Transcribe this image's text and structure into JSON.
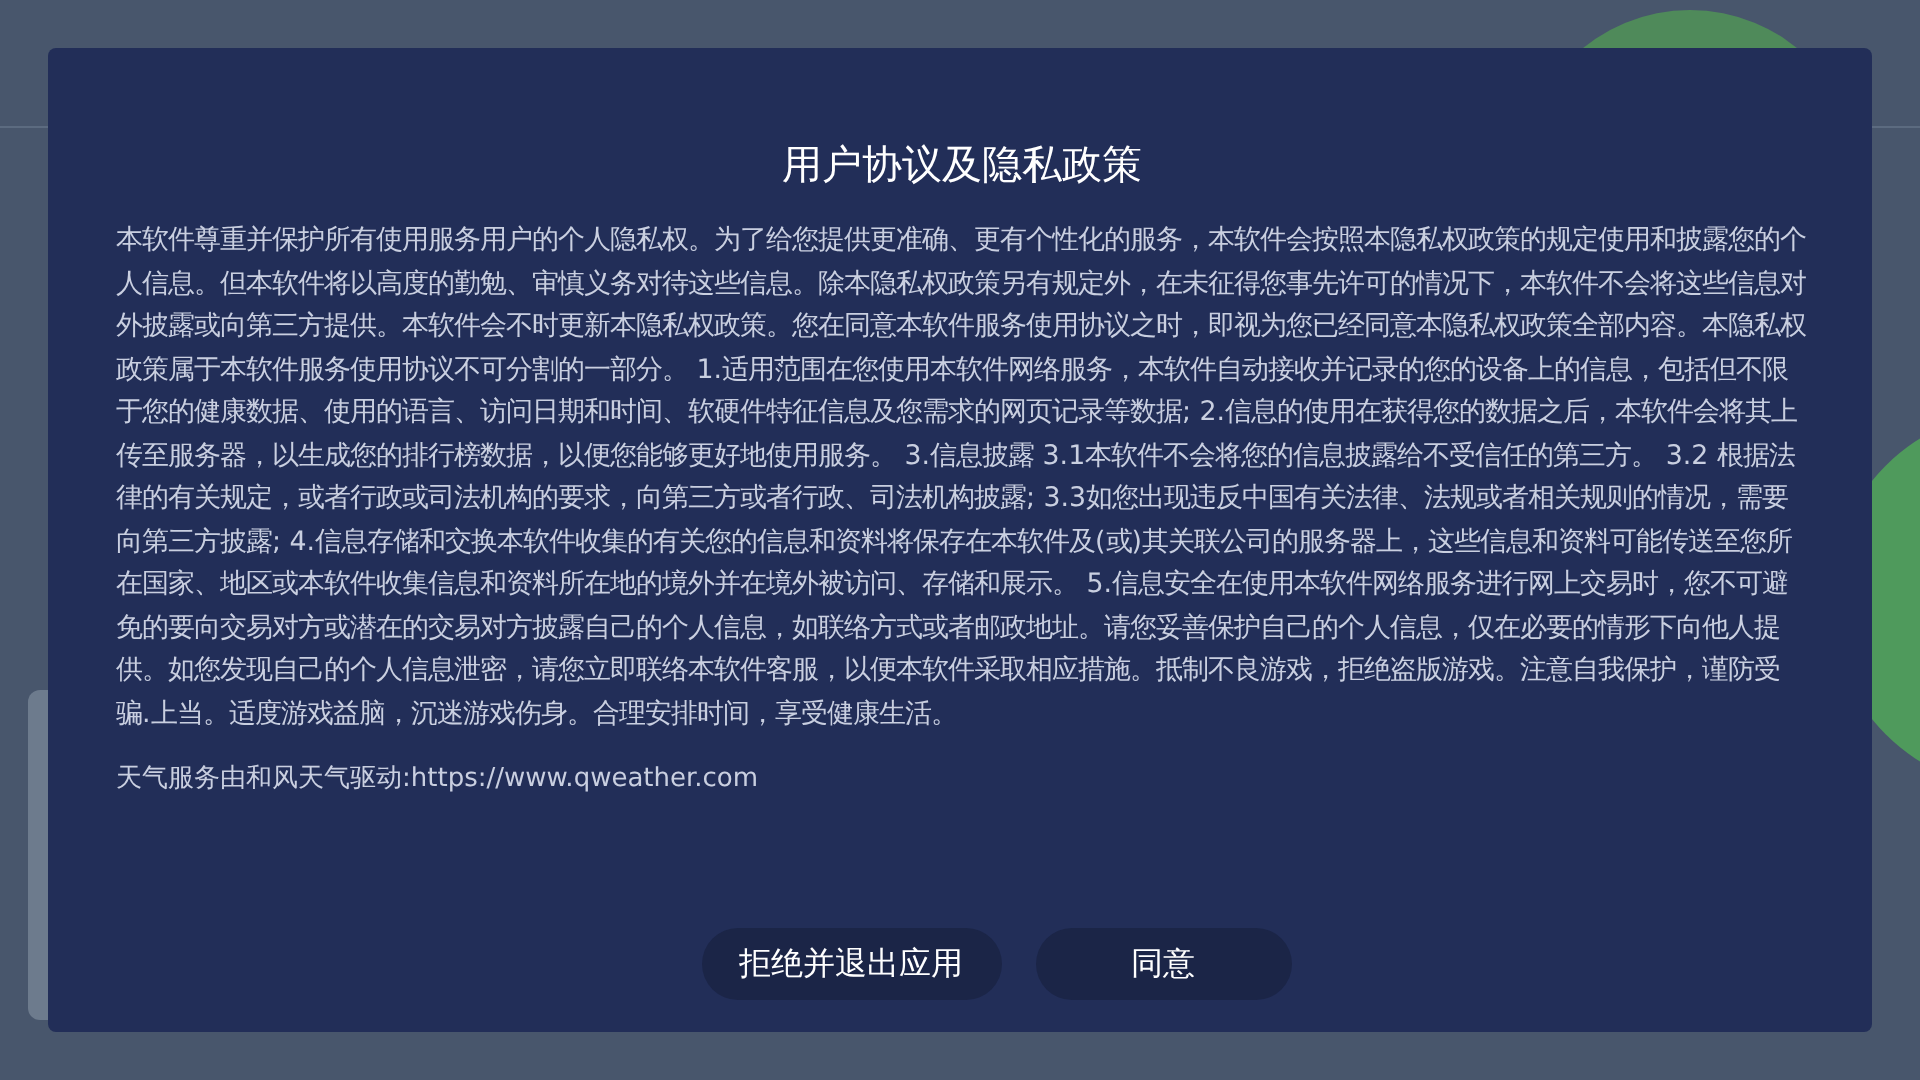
{
  "dialog": {
    "title": "用户协议及隐私政策",
    "body": "本软件尊重并保护所有使用服务用户的个人隐私权。为了给您提供更准确、更有个性化的服务，本软件会按照本隐私权政策的规定使用和披露您的个人信息。但本软件将以高度的勤勉、审慎义务对待这些信息。除本隐私权政策另有规定外，在未征得您事先许可的情况下，本软件不会将这些信息对外披露或向第三方提供。本软件会不时更新本隐私权政策。您在同意本软件服务使用协议之时，即视为您已经同意本隐私权政策全部内容。本隐私权政策属于本软件服务使用协议不可分割的一部分。 1.适用范围在您使用本软件网络服务，本软件自动接收并记录的您的设备上的信息，包括但不限于您的健康数据、使用的语言、访问日期和时间、软硬件特征信息及您需求的网页记录等数据; 2.信息的使用在获得您的数据之后，本软件会将其上传至服务器，以生成您的排行榜数据，以便您能够更好地使用服务。 3.信息披露 3.1本软件不会将您的信息披露给不受信任的第三方。 3.2 根据法律的有关规定，或者行政或司法机构的要求，向第三方或者行政、司法机构披露; 3.3如您出现违反中国有关法律、法规或者相关规则的情况，需要向第三方披露; 4.信息存储和交换本软件收集的有关您的信息和资料将保存在本软件及(或)其关联公司的服务器上，这些信息和资料可能传送至您所在国家、地区或本软件收集信息和资料所在地的境外并在境外被访问、存储和展示。 5.信息安全在使用本软件网络服务进行网上交易时，您不可避免的要向交易对方或潜在的交易对方披露自己的个人信息，如联络方式或者邮政地址。请您妥善保护自己的个人信息，仅在必要的情形下向他人提供。如您发现自己的个人信息泄密，请您立即联络本软件客服，以便本软件采取相应措施。抵制不良游戏，拒绝盗版游戏。注意自我保护，谨防受骗.上当。适度游戏益脑，沉迷游戏伤身。合理安排时间，享受健康生活。",
    "attribution": "天气服务由和风天气驱动:https://www.qweather.com",
    "buttons": [
      {
        "label": "拒绝并退出应用"
      },
      {
        "label": "同意"
      }
    ]
  }
}
